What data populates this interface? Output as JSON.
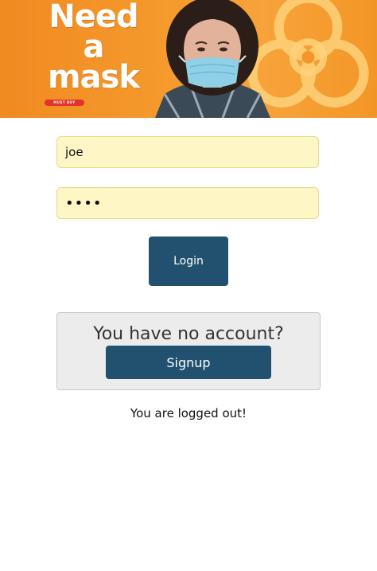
{
  "banner": {
    "title_lines": [
      "Need",
      "a",
      "mask"
    ],
    "tag_text": "MUST BUY",
    "colors": {
      "background": "#f39627",
      "hazard": "#ffd27a",
      "tag": "#e5322b"
    }
  },
  "login_form": {
    "username_value": "joe",
    "password_value": "••••",
    "login_label": "Login"
  },
  "signup": {
    "prompt": "You have no account?",
    "button_label": "Signup"
  },
  "status_message": "You are logged out!",
  "colors": {
    "primary_button": "#21516f",
    "input_background": "#fff6c6",
    "signup_panel": "#ececec"
  }
}
